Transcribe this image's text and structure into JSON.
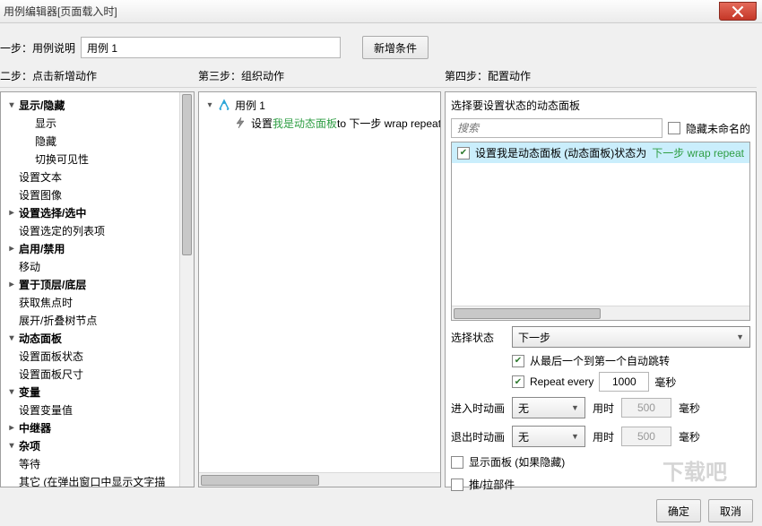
{
  "window": {
    "title": "用例编辑器[页面载入时]"
  },
  "step1": {
    "label": "一步：用例说明",
    "value": "用例 1",
    "add_condition": "新增条件"
  },
  "step_headers": {
    "s2": "二步：点击新增动作",
    "s3": "第三步：组织动作",
    "s4": "第四步：配置动作"
  },
  "actions_tree": [
    {
      "lvl": 0,
      "exp": "down",
      "text": "显示/隐藏",
      "bold": true
    },
    {
      "lvl": 1,
      "text": "显示"
    },
    {
      "lvl": 1,
      "text": "隐藏"
    },
    {
      "lvl": 1,
      "text": "切换可见性"
    },
    {
      "lvl": 0,
      "exp": "none",
      "text": "设置文本"
    },
    {
      "lvl": 0,
      "exp": "none",
      "text": "设置图像"
    },
    {
      "lvl": 0,
      "exp": "right",
      "text": "设置选择/选中",
      "bold": true
    },
    {
      "lvl": 0,
      "exp": "none",
      "text": "设置选定的列表项"
    },
    {
      "lvl": 0,
      "exp": "right",
      "text": "启用/禁用",
      "bold": true
    },
    {
      "lvl": 0,
      "exp": "none",
      "text": "移动"
    },
    {
      "lvl": 0,
      "exp": "right",
      "text": "置于顶层/底层",
      "bold": true
    },
    {
      "lvl": 0,
      "exp": "none",
      "text": "获取焦点时"
    },
    {
      "lvl": 0,
      "exp": "none",
      "text": "展开/折叠树节点"
    },
    {
      "lvl": 0,
      "exp": "down",
      "text": "动态面板",
      "bold": true,
      "cat": true
    },
    {
      "lvl": 0,
      "exp": "none",
      "text": "设置面板状态"
    },
    {
      "lvl": 0,
      "exp": "none",
      "text": "设置面板尺寸"
    },
    {
      "lvl": 0,
      "exp": "down",
      "text": "变量",
      "bold": true,
      "cat": true
    },
    {
      "lvl": 0,
      "exp": "none",
      "text": "设置变量值"
    },
    {
      "lvl": 0,
      "exp": "right",
      "text": "中继器",
      "bold": true,
      "cat": true
    },
    {
      "lvl": 0,
      "exp": "down",
      "text": "杂项",
      "bold": true,
      "cat": true
    },
    {
      "lvl": 0,
      "exp": "none",
      "text": "等待"
    },
    {
      "lvl": 0,
      "exp": "none",
      "text": "其它 (在弹出窗口中显示文字描"
    }
  ],
  "organize": {
    "case_label": "用例 1",
    "action_prefix": "设置 ",
    "action_link": "我是动态面板",
    "action_suffix": " to 下一步 wrap repeat"
  },
  "configure": {
    "section_label": "选择要设置状态的动态面板",
    "search_placeholder": "搜索",
    "hide_unnamed": "隐藏未命名的",
    "panel_item_prefix": "设置我是动态面板 (动态面板)状态为 ",
    "panel_item_link": "下一步 wrap repeat",
    "select_state_label": "选择状态",
    "state_value": "下一步",
    "wrap_label": "从最后一个到第一个自动跳转",
    "repeat_label": "Repeat every",
    "repeat_value": "1000",
    "ms": "毫秒",
    "enter_anim_label": "进入时动画",
    "exit_anim_label": "退出时动画",
    "anim_value": "无",
    "duration_label": "用时",
    "duration_value": "500",
    "show_panel": "显示面板 (如果隐藏)",
    "push_pull": "推/拉部件"
  },
  "buttons": {
    "ok": "确定",
    "cancel": "取消"
  }
}
